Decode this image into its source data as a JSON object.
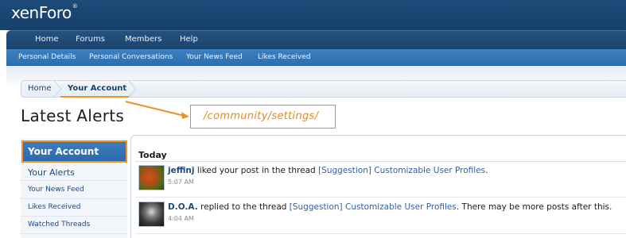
{
  "header": {
    "logo_text": "xenForo",
    "logo_mark": "®",
    "nav_tabs": [
      {
        "label": "Home"
      },
      {
        "label": "Forums"
      },
      {
        "label": "Members"
      },
      {
        "label": "Help"
      }
    ],
    "sub_tabs": [
      {
        "label": "Personal Details"
      },
      {
        "label": "Personal Conversations"
      },
      {
        "label": "Your News Feed"
      },
      {
        "label": "Likes Received"
      }
    ]
  },
  "breadcrumb": {
    "items": [
      {
        "label": "Home"
      },
      {
        "label": "Your Account"
      }
    ]
  },
  "page": {
    "title": "Latest Alerts"
  },
  "annotation": {
    "text": "/community/settings/",
    "color": "#e88a1c"
  },
  "sidebar": {
    "heading": "Your Account",
    "items": [
      {
        "label": "Your Alerts"
      },
      {
        "label": "Your News Feed"
      },
      {
        "label": "Likes Received"
      },
      {
        "label": "Watched Threads"
      }
    ]
  },
  "alerts": {
    "section_label": "Today",
    "items": [
      {
        "user": "jeffinj",
        "text_before": " liked your post in the thread ",
        "link": "[Suggestion] Customizable User Profiles",
        "text_after": ".",
        "time": "5:07 AM"
      },
      {
        "user": "D.O.A.",
        "text_before": " replied to the thread ",
        "link": "[Suggestion] Customizable User Profiles",
        "text_after": ". There may be more posts after this.",
        "time": "4:04 AM"
      }
    ]
  },
  "colors": {
    "header_bg": "#1d4a78",
    "subnav_bg": "#3e7fbf",
    "accent_orange": "#e8942b",
    "link_blue": "#2f62a6"
  }
}
